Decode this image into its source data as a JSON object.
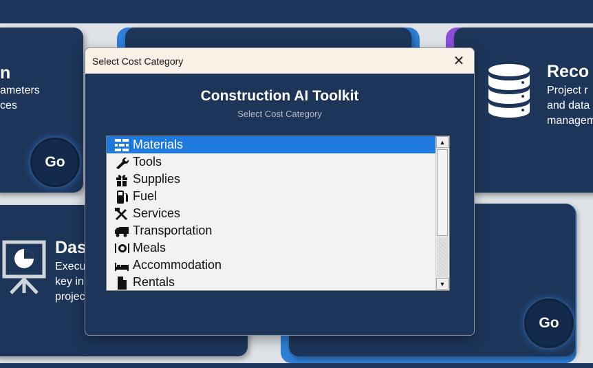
{
  "background": {
    "cards": {
      "tl": {
        "title": "n",
        "desc1": "ameters",
        "desc2": "ces",
        "go": "Go"
      },
      "tr": {
        "title": "Reco",
        "desc1": "Project r",
        "desc2": "and data",
        "desc3": "managem"
      },
      "bl": {
        "title": "Das",
        "desc1": "Execu",
        "desc2": "key in",
        "desc3": "projec"
      },
      "br": {
        "go": "Go"
      }
    },
    "colors": {
      "navy": "#1d3559",
      "accent_blue": "#2f7fd6",
      "accent_purple": "#8a4fd6"
    }
  },
  "dialog": {
    "title": "Select Cost Category",
    "close_glyph": "✕",
    "heading": "Construction AI Toolkit",
    "subheading": "Select Cost Category",
    "selected_index": 0,
    "items": [
      {
        "label": "Materials",
        "icon": "brick-icon"
      },
      {
        "label": "Tools",
        "icon": "wrench-icon"
      },
      {
        "label": "Supplies",
        "icon": "gift-box-icon"
      },
      {
        "label": "Fuel",
        "icon": "fuel-pump-icon"
      },
      {
        "label": "Services",
        "icon": "hammer-wrench-icon"
      },
      {
        "label": "Transportation",
        "icon": "truck-icon"
      },
      {
        "label": "Meals",
        "icon": "plate-icon"
      },
      {
        "label": "Accommodation",
        "icon": "bed-icon"
      },
      {
        "label": "Rentals",
        "icon": "document-icon"
      }
    ],
    "scroll_up": "▲",
    "scroll_down": "▼"
  }
}
